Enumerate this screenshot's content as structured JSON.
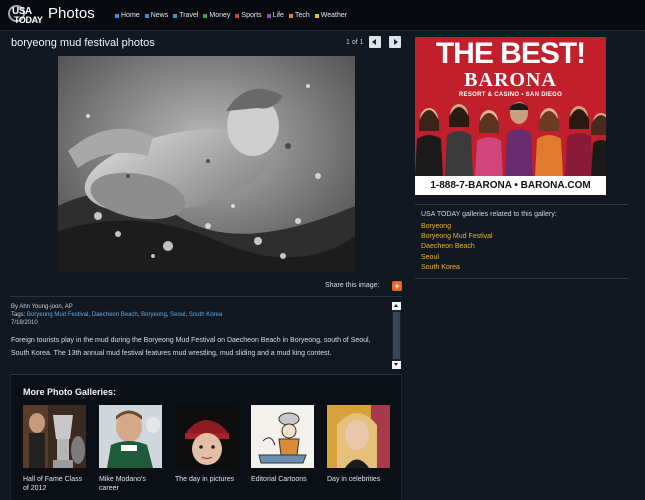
{
  "header": {
    "logo_top": "USA",
    "logo_bottom": "TODAY",
    "section": "Photos",
    "nav": [
      {
        "label": "Home",
        "color": "#3b8ad9"
      },
      {
        "label": "News",
        "color": "#3b8ad9"
      },
      {
        "label": "Travel",
        "color": "#1fa0b8"
      },
      {
        "label": "Money",
        "color": "#3fa143"
      },
      {
        "label": "Sports",
        "color": "#d43b2e"
      },
      {
        "label": "Life",
        "color": "#8a52b8"
      },
      {
        "label": "Tech",
        "color": "#e0892c"
      },
      {
        "label": "Weather",
        "color": "#e6c21e"
      }
    ]
  },
  "gallery": {
    "title": "boryeong mud festival photos",
    "counter": "1 of 1",
    "share_label": "Share this image:",
    "byline": "By Ahn Young-joon, AP",
    "tags_label": "Tags:",
    "tags": [
      "Boryeong Mud Festival",
      "Daecheon Beach",
      "Boryeong",
      "Seoul",
      "South Korea"
    ],
    "date": "7/18/2010",
    "caption": "Foreign tourists play in the mud during the Boryeong Mud Festival on Daecheon Beach in Boryeong, south of Seoul, South Korea. The 13th annual mud festival features mud wrestling, mud sliding and a mud king contest."
  },
  "more_galleries": {
    "title": "More Photo Galleries:",
    "items": [
      {
        "label": "Hall of Fame Class of 2012"
      },
      {
        "label": "Mike Modano's career"
      },
      {
        "label": "The day in pictures"
      },
      {
        "label": "Editorial Cartoons"
      },
      {
        "label": "Day in celebrities"
      }
    ]
  },
  "ad": {
    "headline": "THE BEST!",
    "brand": "BARONA",
    "subline": "RESORT & CASINO • SAN DIEGO",
    "phone": "1-888-7-BARONA • BARONA.COM"
  },
  "related": {
    "heading": "USA TODAY galleries related to this gallery:",
    "links": [
      "Boryeong",
      "Boryeong Mud Festival",
      "Daecheon Beach",
      "Seoul",
      "South Korea"
    ]
  }
}
